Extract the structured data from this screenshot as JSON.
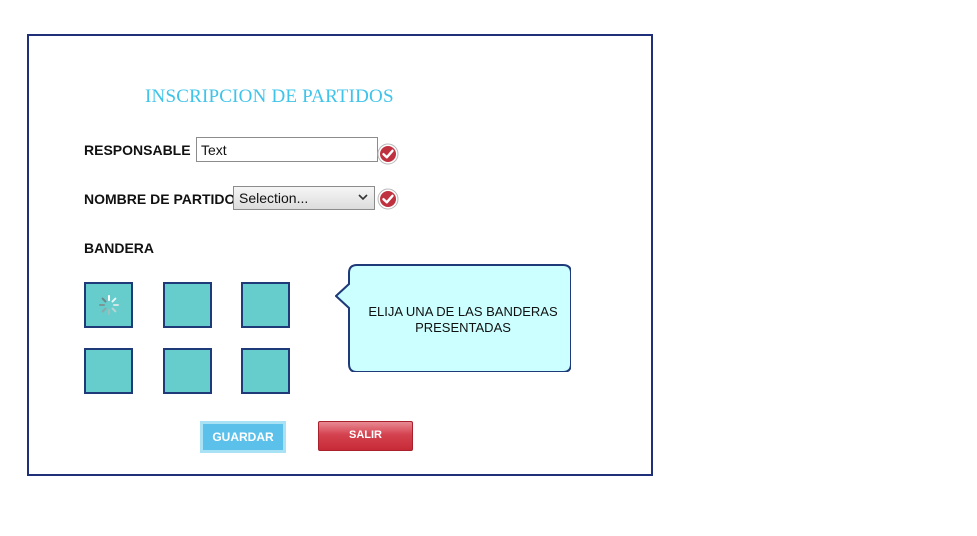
{
  "form": {
    "title": "INSCRIPCION DE PARTIDOS",
    "responsable_label": "RESPONSABLE",
    "responsable_value": "Text",
    "nombre_label": "NOMBRE DE PARTIDO",
    "nombre_selected": "Selection...",
    "bandera_label": "BANDERA"
  },
  "flags": {
    "count": 6,
    "loading_index": 0,
    "color": "#66cccc",
    "border_color": "#1e3a78"
  },
  "tooltip": {
    "line1": "ELIJA UNA DE LAS BANDERAS",
    "line2": "PRESENTADAS",
    "background": "#ccffff",
    "border_color": "#1e3a78"
  },
  "buttons": {
    "guardar_label": "GUARDAR",
    "salir_label": "SALIR"
  },
  "colors": {
    "frame_border": "#1f2f7a",
    "title": "#3ec3ea",
    "guardar": "#5bc0ea",
    "salir": "#d4424f",
    "check": "#c0313f"
  },
  "icons": {
    "validation": "check-circle-icon",
    "dropdown": "chevron-down-icon",
    "loading": "spinner-icon"
  }
}
